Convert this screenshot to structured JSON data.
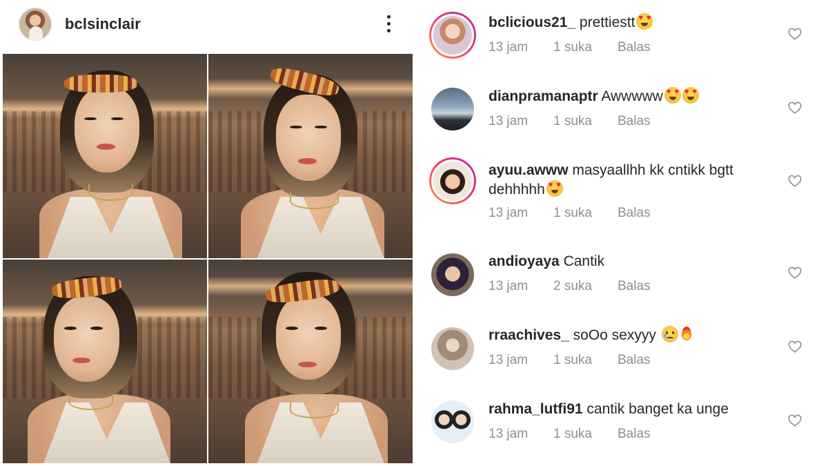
{
  "post": {
    "username": "bclsinclair",
    "more_icon": "more-vertical-icon"
  },
  "comments": [
    {
      "username": "bclicious21_",
      "text": "prettiestt",
      "emojis": [
        "heart-eyes"
      ],
      "time": "13 jam",
      "likes": "1 suka",
      "reply": "Balas",
      "story_ring": true
    },
    {
      "username": "dianpramanaptr",
      "text": "Awwwww",
      "emojis": [
        "heart-eyes",
        "heart-eyes"
      ],
      "time": "13 jam",
      "likes": "1 suka",
      "reply": "Balas",
      "story_ring": false
    },
    {
      "username": "ayuu.awww",
      "text": "masyaallhh kk cntikk bgtt dehhhhh",
      "emojis": [
        "heart-eyes"
      ],
      "time": "13 jam",
      "likes": "1 suka",
      "reply": "Balas",
      "story_ring": true
    },
    {
      "username": "andioyaya",
      "text": "Cantik",
      "emojis": [],
      "time": "13 jam",
      "likes": "2 suka",
      "reply": "Balas",
      "story_ring": false
    },
    {
      "username": "rraachives_",
      "text": "soOo sexyyy",
      "emojis": [
        "sad",
        "fire"
      ],
      "time": "13 jam",
      "likes": "1 suka",
      "reply": "Balas",
      "story_ring": false
    },
    {
      "username": "rahma_lutfi91",
      "text": "cantik banget ka unge",
      "emojis": [],
      "time": "13 jam",
      "likes": "1 suka",
      "reply": "Balas",
      "story_ring": false
    }
  ],
  "icons": {
    "like": "heart-outline-icon"
  },
  "colors": {
    "text": "#262626",
    "meta": "#8e8e8e",
    "story_ring_start": "#f9a23b",
    "story_ring_end": "#b72fa3"
  }
}
